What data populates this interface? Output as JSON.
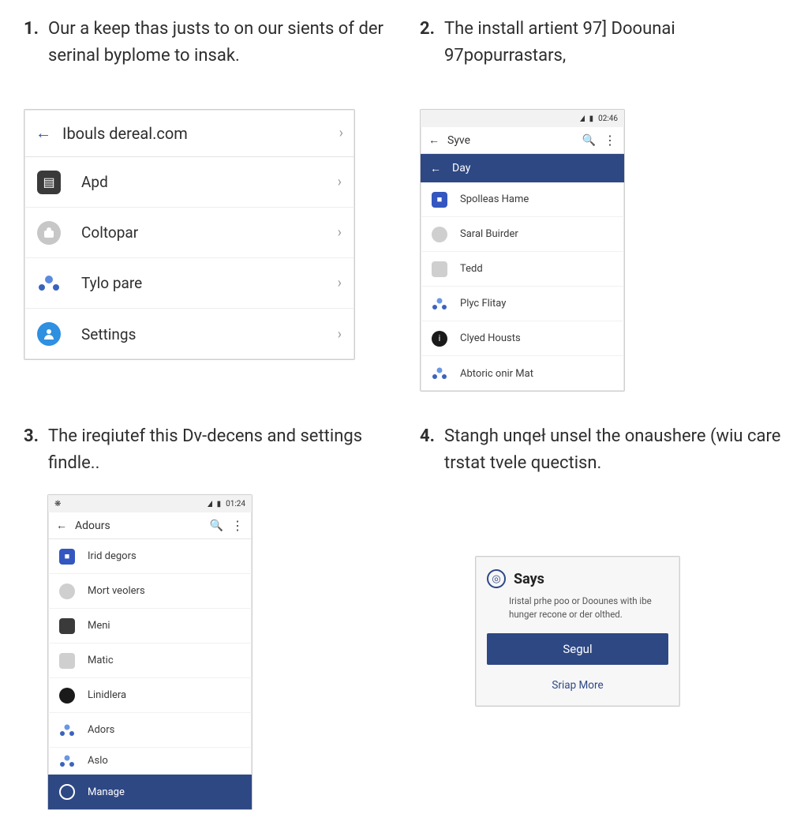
{
  "steps": {
    "s1": {
      "num": "1.",
      "text": "Our a keep thas justs to on our sients of der serinal byplome to insak."
    },
    "s2": {
      "num": "2.",
      "text": "The install artient 97] Doounai 97popurrastars,"
    },
    "s3": {
      "num": "3.",
      "text": "The ireqiutef this Dv-decens and settings findle.."
    },
    "s4": {
      "num": "4.",
      "text": "Stangh unqeł unsel the onaushere (wiu care trstat tvele quectisn."
    }
  },
  "panel1": {
    "title": "Ibouls dereal.com",
    "rows": [
      {
        "icon": "apd",
        "label": "Apd"
      },
      {
        "icon": "colt",
        "label": "Coltopar"
      },
      {
        "icon": "tylo",
        "label": "Tylo pare"
      },
      {
        "icon": "settings",
        "label": "Settings"
      }
    ]
  },
  "panel2": {
    "clock": "02:46",
    "appbar_title": "Syve",
    "bluebar_title": "Day",
    "rows": [
      {
        "icon": "blue",
        "label": "Spolleas Hame"
      },
      {
        "icon": "grey",
        "label": "Saral Buirder"
      },
      {
        "icon": "sq",
        "label": "Tedd"
      },
      {
        "icon": "person",
        "label": "Plyc Flitay"
      },
      {
        "icon": "dark",
        "label": "Clyed Housts"
      },
      {
        "icon": "person",
        "label": "Abtoric onir Mat"
      }
    ]
  },
  "panel3": {
    "clock": "01:24",
    "appbar_title": "Adours",
    "rows": [
      {
        "icon": "blue",
        "label": "Irid degors"
      },
      {
        "icon": "grey",
        "label": "Mort veolers"
      },
      {
        "icon": "darksq",
        "label": "Meni"
      },
      {
        "icon": "sq",
        "label": "Matic"
      },
      {
        "icon": "dark",
        "label": "Linidlera"
      },
      {
        "icon": "person",
        "label": "Adors"
      },
      {
        "icon": "person",
        "label": "Aslo"
      },
      {
        "icon": "target",
        "label": "Manage",
        "selected": true
      }
    ]
  },
  "panel4": {
    "title": "Says",
    "body": "Iristal prhe poo or Doounes with ibe hunger recone or der olthed.",
    "primary": "Segul",
    "link": "Sriap More"
  }
}
